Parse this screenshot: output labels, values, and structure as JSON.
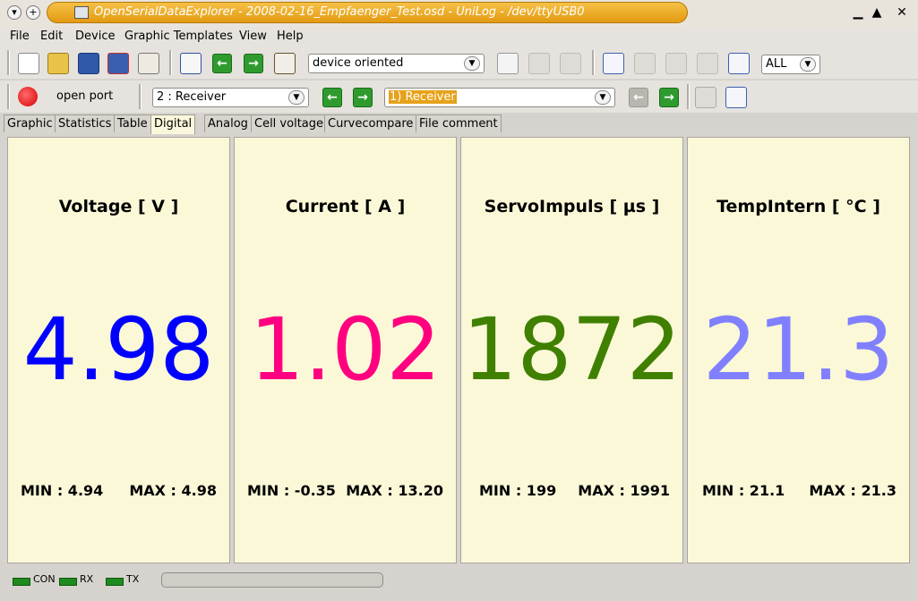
{
  "window": {
    "title": "OpenSerialDataExplorer  -  2008-02-16_Empfaenger_Test.osd  -  UniLog  - /dev/ttyUSB0"
  },
  "menu": [
    "File",
    "Edit",
    "Device",
    "Graphic Templates",
    "View",
    "Help"
  ],
  "toolbar1": {
    "view_mode": "device oriented",
    "filter": "ALL"
  },
  "toolbar2": {
    "port_label": "open port",
    "channel": "2 : Receiver",
    "record": "1) Receiver"
  },
  "tabs": [
    "Graphic",
    "Statistics",
    "Table",
    "Digital",
    "Analog",
    "Cell voltage",
    "Curvecompare",
    "File comment"
  ],
  "active_tab": "Digital",
  "panels": [
    {
      "title": "Voltage [ V ]",
      "value": "4.98",
      "color": "#0000ff",
      "min": "MIN : 4.94",
      "max": "MAX : 4.98"
    },
    {
      "title": "Current [ A ]",
      "value": "1.02",
      "color": "#ff0080",
      "min": "MIN : -0.35",
      "max": "MAX : 13.20"
    },
    {
      "title": "ServoImpuls [ µs ]",
      "value": "1872",
      "color": "#408000",
      "min": "MIN : 199",
      "max": "MAX : 1991"
    },
    {
      "title": "TempIntern [ °C ]",
      "value": "21.3",
      "color": "#8080ff",
      "min": "MIN : 21.1",
      "max": "MAX : 21.3"
    }
  ],
  "status": {
    "con": "CON",
    "rx": "RX",
    "tx": "TX"
  }
}
